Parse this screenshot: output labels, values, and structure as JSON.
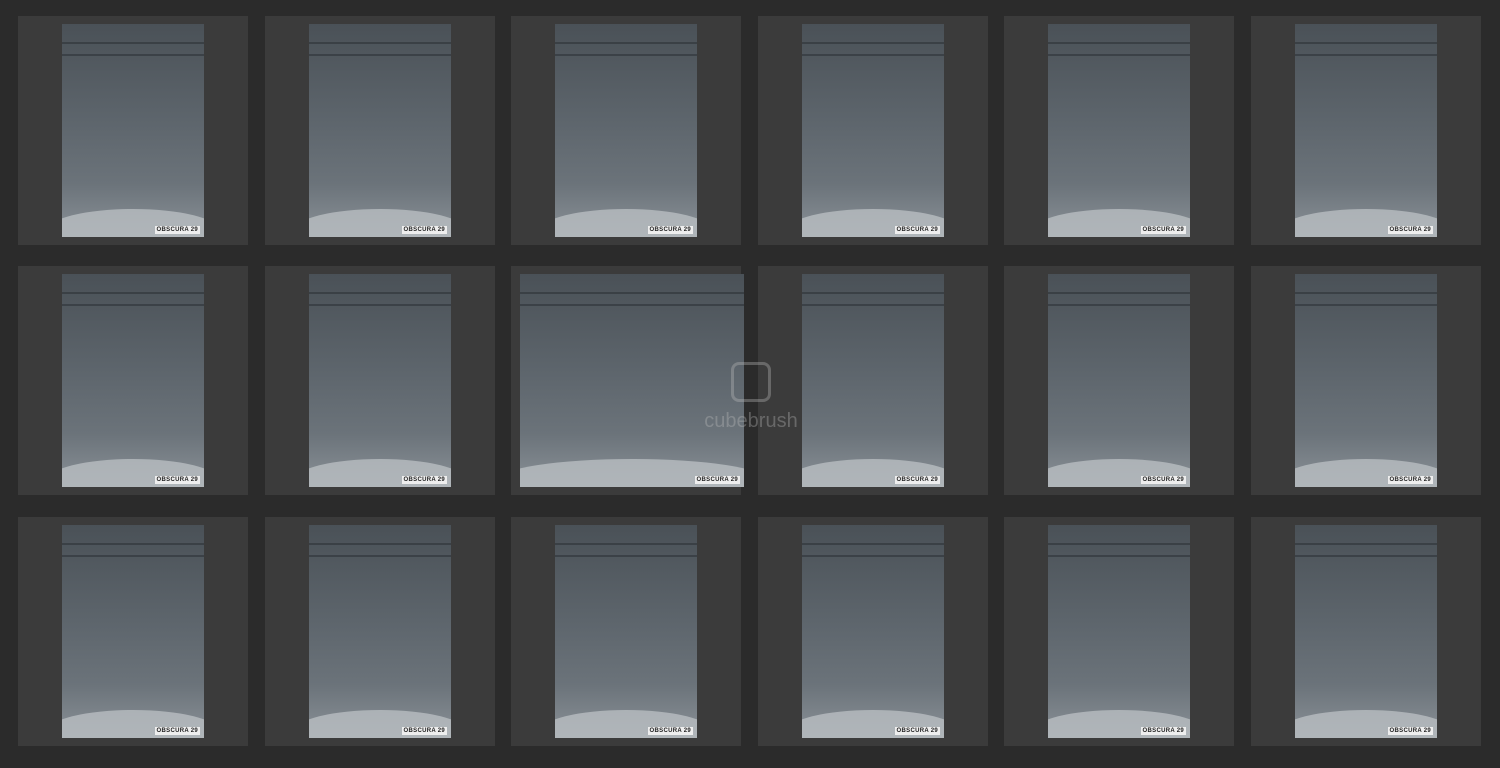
{
  "grid": {
    "rows": 3,
    "columns": 6
  },
  "photos": [
    {
      "watermark": "OBSCURA 29",
      "wide": false
    },
    {
      "watermark": "OBSCURA 29",
      "wide": false
    },
    {
      "watermark": "OBSCURA 29",
      "wide": false
    },
    {
      "watermark": "OBSCURA 29",
      "wide": false
    },
    {
      "watermark": "OBSCURA 29",
      "wide": false
    },
    {
      "watermark": "OBSCURA 29",
      "wide": false
    },
    {
      "watermark": "OBSCURA 29",
      "wide": false
    },
    {
      "watermark": "OBSCURA 29",
      "wide": false
    },
    {
      "watermark": "OBSCURA 29",
      "wide": true
    },
    {
      "watermark": "OBSCURA 29",
      "wide": false
    },
    {
      "watermark": "OBSCURA 29",
      "wide": false
    },
    {
      "watermark": "OBSCURA 29",
      "wide": false
    },
    {
      "watermark": "OBSCURA 29",
      "wide": false
    },
    {
      "watermark": "OBSCURA 29",
      "wide": false
    },
    {
      "watermark": "OBSCURA 29",
      "wide": false
    },
    {
      "watermark": "OBSCURA 29",
      "wide": false
    },
    {
      "watermark": "OBSCURA 29",
      "wide": false
    },
    {
      "watermark": "OBSCURA 29",
      "wide": false
    }
  ],
  "site_watermark": "cubebrush"
}
